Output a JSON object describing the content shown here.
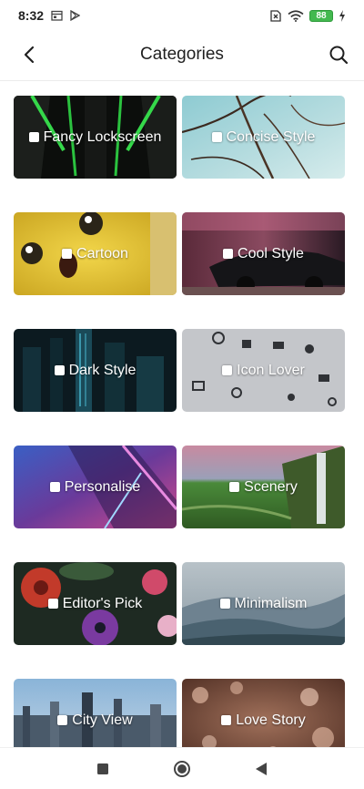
{
  "status_bar": {
    "time": "8:32",
    "battery": "88",
    "icons": [
      "calendar-icon",
      "play-store-icon",
      "sim-x-icon",
      "wifi-icon",
      "battery-icon",
      "charging-bolt-icon"
    ]
  },
  "app_bar": {
    "title": "Categories",
    "back_icon": "back-arrow-icon",
    "search_icon": "search-icon"
  },
  "categories": [
    {
      "label": "Fancy Lockscreen"
    },
    {
      "label": "Concise Style"
    },
    {
      "label": "Cartoon"
    },
    {
      "label": "Cool Style"
    },
    {
      "label": "Dark Style"
    },
    {
      "label": "Icon Lover"
    },
    {
      "label": "Personalise"
    },
    {
      "label": "Scenery"
    },
    {
      "label": "Editor's Pick"
    },
    {
      "label": "Minimalism"
    },
    {
      "label": "City View"
    },
    {
      "label": "Love Story"
    }
  ],
  "nav_bar": {
    "icons": [
      "recents-square-icon",
      "home-circle-icon",
      "back-triangle-icon"
    ]
  },
  "colors": {
    "background": "#ffffff",
    "text": "#1f1f1f",
    "battery_green": "#43b94f"
  }
}
